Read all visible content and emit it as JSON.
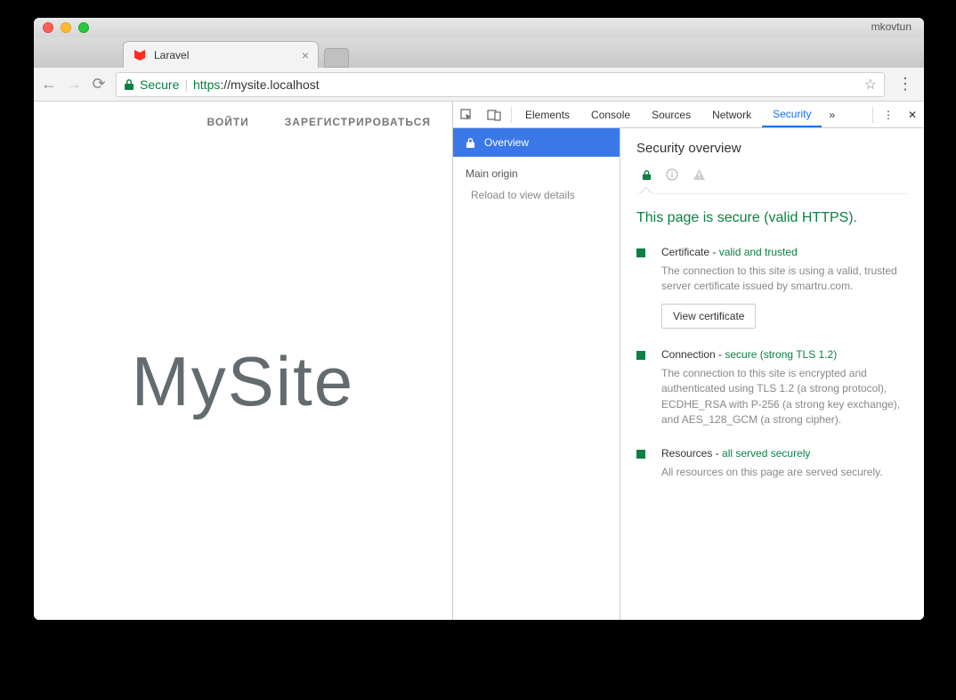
{
  "chrome": {
    "profile": "mkovtun",
    "tab_title": "Laravel",
    "favicon_color": "#ff2d20",
    "secure_label": "Secure",
    "url_https": "https",
    "url_rest": "://mysite.localhost"
  },
  "page": {
    "nav": {
      "login": "ВОЙТИ",
      "register": "ЗАРЕГИСТРИРОВАТЬСЯ"
    },
    "hero": "MySite"
  },
  "devtools": {
    "tabs": {
      "elements": "Elements",
      "console": "Console",
      "sources": "Sources",
      "network": "Network",
      "security": "Security"
    },
    "overview_label": "Overview",
    "main_origin_label": "Main origin",
    "reload_hint": "Reload to view details",
    "panel_title": "Security overview",
    "secure_headline": "This page is secure (valid HTTPS).",
    "cert": {
      "title_pre": "Certificate - ",
      "title_em": "valid and trusted",
      "desc": "The connection to this site is using a valid, trusted server certificate issued by smartru.com.",
      "button": "View certificate"
    },
    "conn": {
      "title_pre": "Connection - ",
      "title_em": "secure (strong TLS 1.2)",
      "desc": "The connection to this site is encrypted and authenticated using TLS 1.2 (a strong protocol), ECDHE_RSA with P-256 (a strong key exchange), and AES_128_GCM (a strong cipher)."
    },
    "res": {
      "title_pre": "Resources - ",
      "title_em": "all served securely",
      "desc": "All resources on this page are served securely."
    }
  }
}
